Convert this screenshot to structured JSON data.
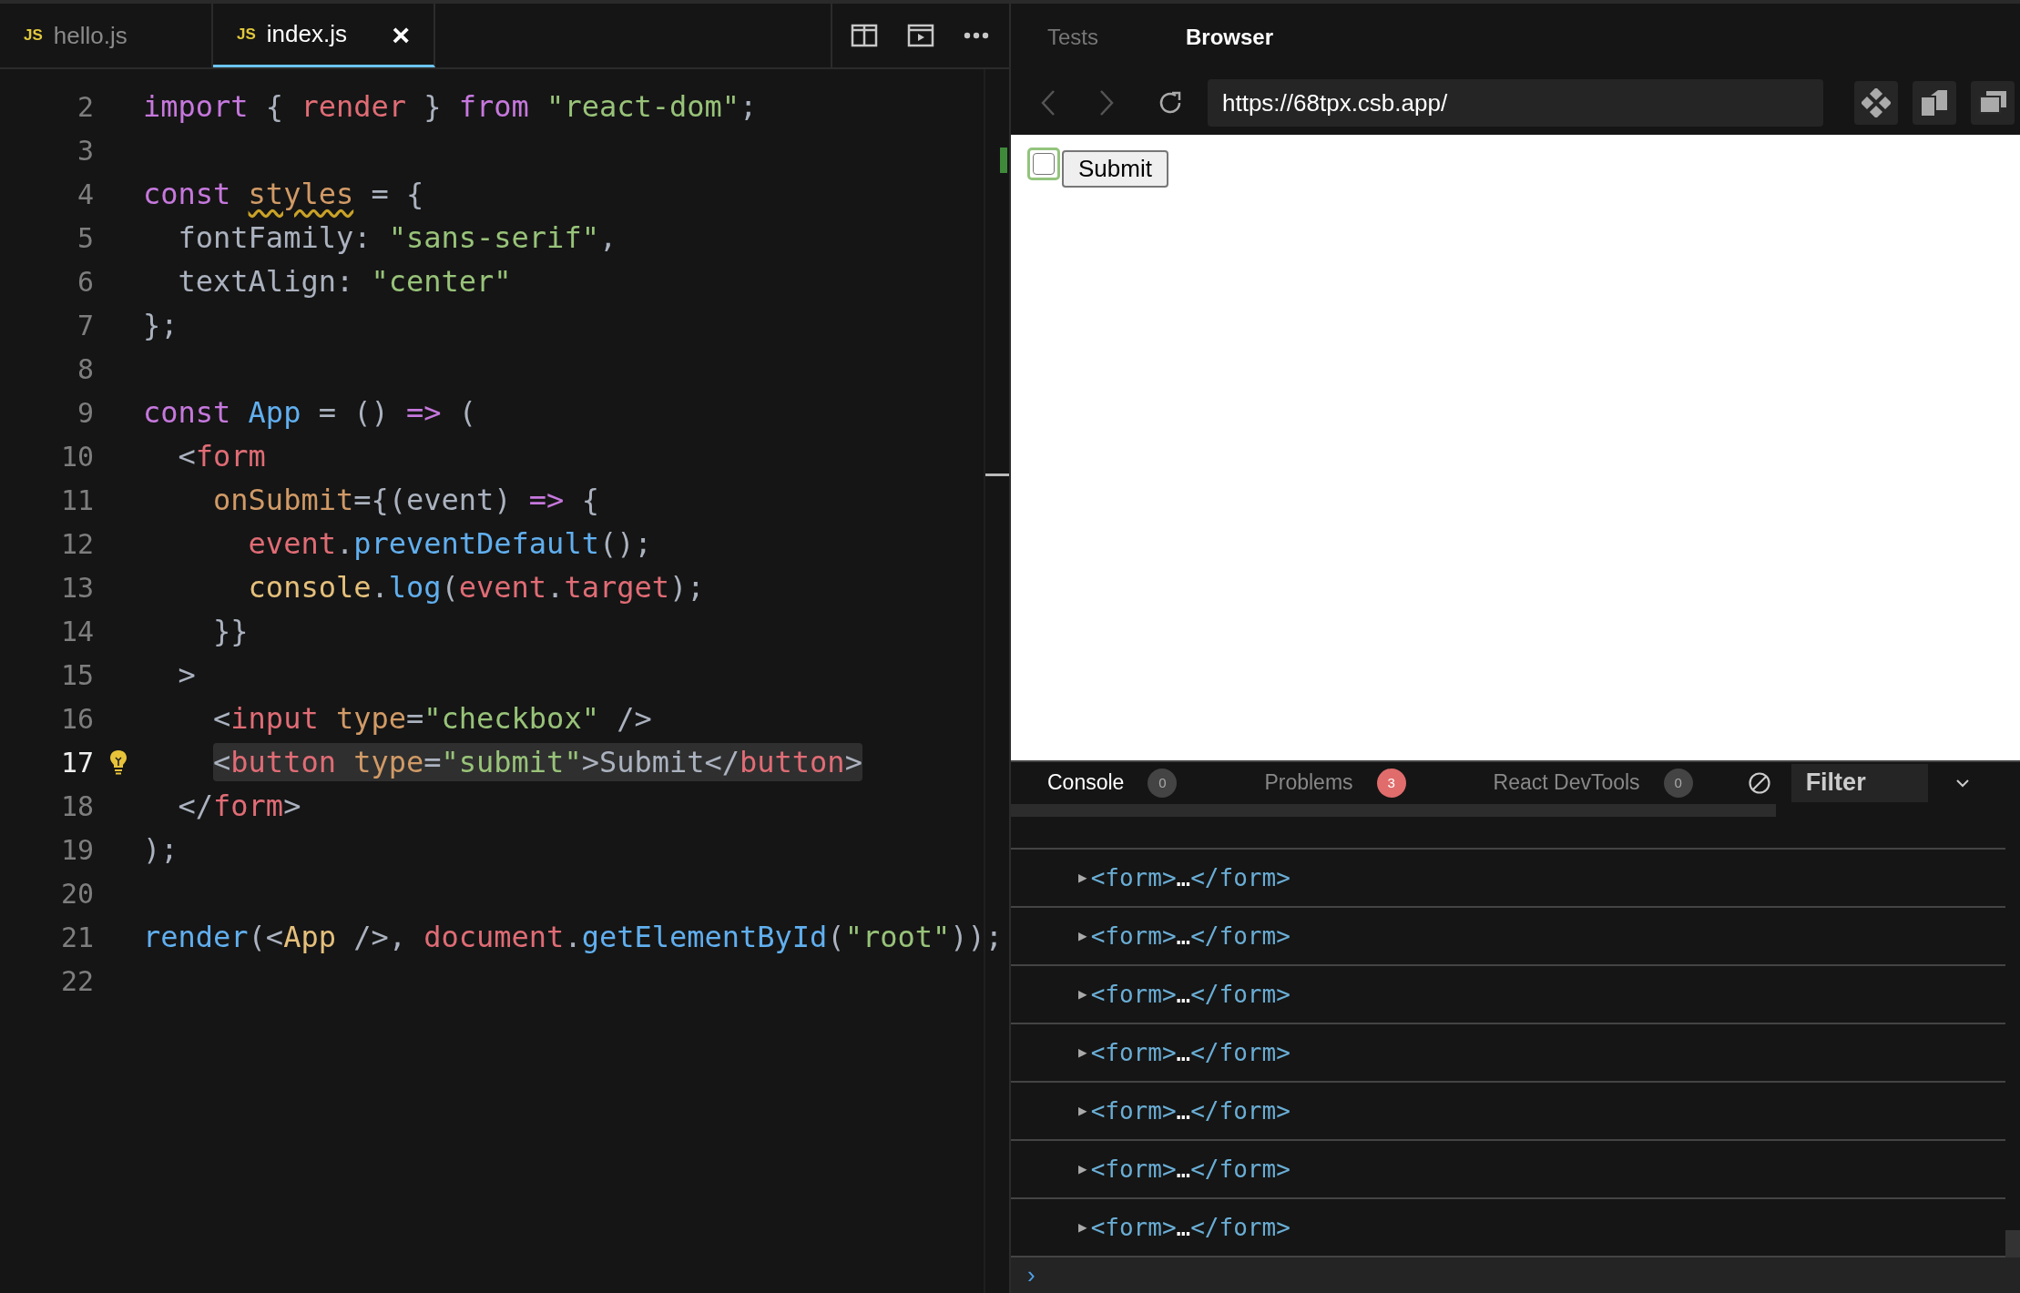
{
  "editor": {
    "tabs": [
      {
        "label": "hello.js",
        "badge": "JS",
        "selected": false,
        "closable": false
      },
      {
        "label": "index.js",
        "badge": "JS",
        "selected": true,
        "closable": true
      }
    ],
    "close_glyph": "×",
    "lines": [
      {
        "number": "2",
        "current": false,
        "highlighted": false,
        "tokens": [
          {
            "text": "import",
            "kind": "kw"
          },
          {
            "text": " { ",
            "kind": "plain"
          },
          {
            "text": "render",
            "kind": "var"
          },
          {
            "text": " } ",
            "kind": "plain"
          },
          {
            "text": "from ",
            "kind": "kw"
          },
          {
            "text": "\"react-dom\"",
            "kind": "str"
          },
          {
            "text": ";",
            "kind": "plain"
          }
        ]
      },
      {
        "number": "3",
        "current": false
      },
      {
        "number": "4",
        "current": false,
        "highlighted": false,
        "tokens": [
          {
            "text": "const ",
            "kind": "kw"
          },
          {
            "text": "styles",
            "kind": "warn"
          },
          {
            "text": " = {",
            "kind": "plain"
          }
        ]
      },
      {
        "number": "5",
        "current": false,
        "highlighted": false,
        "tokens": [
          {
            "text": "  fontFamily: ",
            "kind": "plain"
          },
          {
            "text": "\"sans-serif\"",
            "kind": "str"
          },
          {
            "text": ",",
            "kind": "plain"
          }
        ]
      },
      {
        "number": "6",
        "current": false,
        "highlighted": false,
        "tokens": [
          {
            "text": "  textAlign: ",
            "kind": "plain"
          },
          {
            "text": "\"center\"",
            "kind": "str"
          }
        ]
      },
      {
        "number": "7",
        "current": false,
        "highlighted": false,
        "tokens": [
          {
            "text": "};",
            "kind": "plain"
          }
        ]
      },
      {
        "number": "8",
        "current": false
      },
      {
        "number": "9",
        "current": false,
        "highlighted": false,
        "tokens": [
          {
            "text": "const ",
            "kind": "kw"
          },
          {
            "text": "App",
            "kind": "fn"
          },
          {
            "text": " = () ",
            "kind": "plain"
          },
          {
            "text": "=>",
            "kind": "kw"
          },
          {
            "text": " (",
            "kind": "plain"
          }
        ]
      },
      {
        "number": "10",
        "current": false,
        "highlighted": false,
        "tokens": [
          {
            "text": "  <",
            "kind": "plain"
          },
          {
            "text": "form",
            "kind": "var"
          }
        ]
      },
      {
        "number": "11",
        "current": false,
        "highlighted": false,
        "tokens": [
          {
            "text": "    onSubmit",
            "kind": "attr"
          },
          {
            "text": "={(event) ",
            "kind": "plain"
          },
          {
            "text": "=>",
            "kind": "kw"
          },
          {
            "text": " {",
            "kind": "plain"
          }
        ]
      },
      {
        "number": "12",
        "current": false,
        "highlighted": false,
        "tokens": [
          {
            "text": "      event",
            "kind": "var"
          },
          {
            "text": ".",
            "kind": "plain"
          },
          {
            "text": "preventDefault",
            "kind": "fn"
          },
          {
            "text": "();",
            "kind": "plain"
          }
        ]
      },
      {
        "number": "13",
        "current": false,
        "highlighted": false,
        "tokens": [
          {
            "text": "      console",
            "kind": "type"
          },
          {
            "text": ".",
            "kind": "plain"
          },
          {
            "text": "log",
            "kind": "fn"
          },
          {
            "text": "(",
            "kind": "plain"
          },
          {
            "text": "event",
            "kind": "var"
          },
          {
            "text": ".",
            "kind": "plain"
          },
          {
            "text": "target",
            "kind": "var"
          },
          {
            "text": ");",
            "kind": "plain"
          }
        ]
      },
      {
        "number": "14",
        "current": false,
        "highlighted": false,
        "tokens": [
          {
            "text": "    }}",
            "kind": "plain"
          }
        ]
      },
      {
        "number": "15",
        "current": false,
        "highlighted": false,
        "tokens": [
          {
            "text": "  >",
            "kind": "plain"
          }
        ]
      },
      {
        "number": "16",
        "current": false,
        "highlighted": false,
        "tokens": [
          {
            "text": "    <",
            "kind": "plain"
          },
          {
            "text": "input ",
            "kind": "var"
          },
          {
            "text": "type",
            "kind": "attr"
          },
          {
            "text": "=",
            "kind": "plain"
          },
          {
            "text": "\"checkbox\"",
            "kind": "str"
          },
          {
            "text": " />",
            "kind": "plain"
          }
        ]
      },
      {
        "number": "17",
        "current": true,
        "highlighted": true,
        "lightbulb": true,
        "tokens": [
          {
            "text": "    <",
            "kind": "plain"
          },
          {
            "text": "button ",
            "kind": "var"
          },
          {
            "text": "type",
            "kind": "attr"
          },
          {
            "text": "=",
            "kind": "plain"
          },
          {
            "text": "\"submit\"",
            "kind": "str"
          },
          {
            "text": ">Submit</",
            "kind": "plain"
          },
          {
            "text": "button",
            "kind": "var"
          },
          {
            "text": ">",
            "kind": "plain"
          }
        ]
      },
      {
        "number": "18",
        "current": false,
        "highlighted": false,
        "tokens": [
          {
            "text": "  </",
            "kind": "plain"
          },
          {
            "text": "form",
            "kind": "var"
          },
          {
            "text": ">",
            "kind": "plain"
          }
        ]
      },
      {
        "number": "19",
        "current": false,
        "highlighted": false,
        "tokens": [
          {
            "text": ");",
            "kind": "plain"
          }
        ]
      },
      {
        "number": "20",
        "current": false
      },
      {
        "number": "21",
        "current": false,
        "highlighted": false,
        "tokens": [
          {
            "text": "render",
            "kind": "fn"
          },
          {
            "text": "(<",
            "kind": "plain"
          },
          {
            "text": "App",
            "kind": "type"
          },
          {
            "text": " />, ",
            "kind": "plain"
          },
          {
            "text": "document",
            "kind": "var"
          },
          {
            "text": ".",
            "kind": "plain"
          },
          {
            "text": "getElementById",
            "kind": "fn"
          },
          {
            "text": "(",
            "kind": "plain"
          },
          {
            "text": "\"root\"",
            "kind": "str"
          },
          {
            "text": "));",
            "kind": "plain"
          }
        ]
      },
      {
        "number": "22",
        "current": false
      }
    ]
  },
  "panel": {
    "tabs": [
      {
        "label": "Tests",
        "selected": false
      },
      {
        "label": "Browser",
        "selected": true
      }
    ],
    "browser": {
      "back_disabled": true,
      "forward_disabled": true,
      "url": "https://68tpx.csb.app/",
      "preview": {
        "checkbox": {
          "checked": false,
          "focused": true
        },
        "button": "Submit"
      }
    }
  },
  "devtools": {
    "tabs": [
      {
        "label": "Console",
        "count": "0",
        "selected": true,
        "alert": false
      },
      {
        "label": "Problems",
        "count": "3",
        "selected": false,
        "alert": true
      },
      {
        "label": "React DevTools",
        "count": "0",
        "selected": false,
        "alert": false
      }
    ],
    "filter": {
      "placeholder": "Filter"
    },
    "rows": [
      {
        "expander": "▶",
        "open": "<form>",
        "ellipsis": "…",
        "close": "</form>"
      },
      {
        "expander": "▶",
        "open": "<form>",
        "ellipsis": "…",
        "close": "</form>"
      },
      {
        "expander": "▶",
        "open": "<form>",
        "ellipsis": "…",
        "close": "</form>"
      },
      {
        "expander": "▶",
        "open": "<form>",
        "ellipsis": "…",
        "close": "</form>"
      },
      {
        "expander": "▶",
        "open": "<form>",
        "ellipsis": "…",
        "close": "</form>"
      },
      {
        "expander": "▶",
        "open": "<form>",
        "ellipsis": "…",
        "close": "</form>"
      },
      {
        "expander": "▶",
        "open": "<form>",
        "ellipsis": "…",
        "close": "</form>"
      }
    ],
    "prompt": "›"
  }
}
